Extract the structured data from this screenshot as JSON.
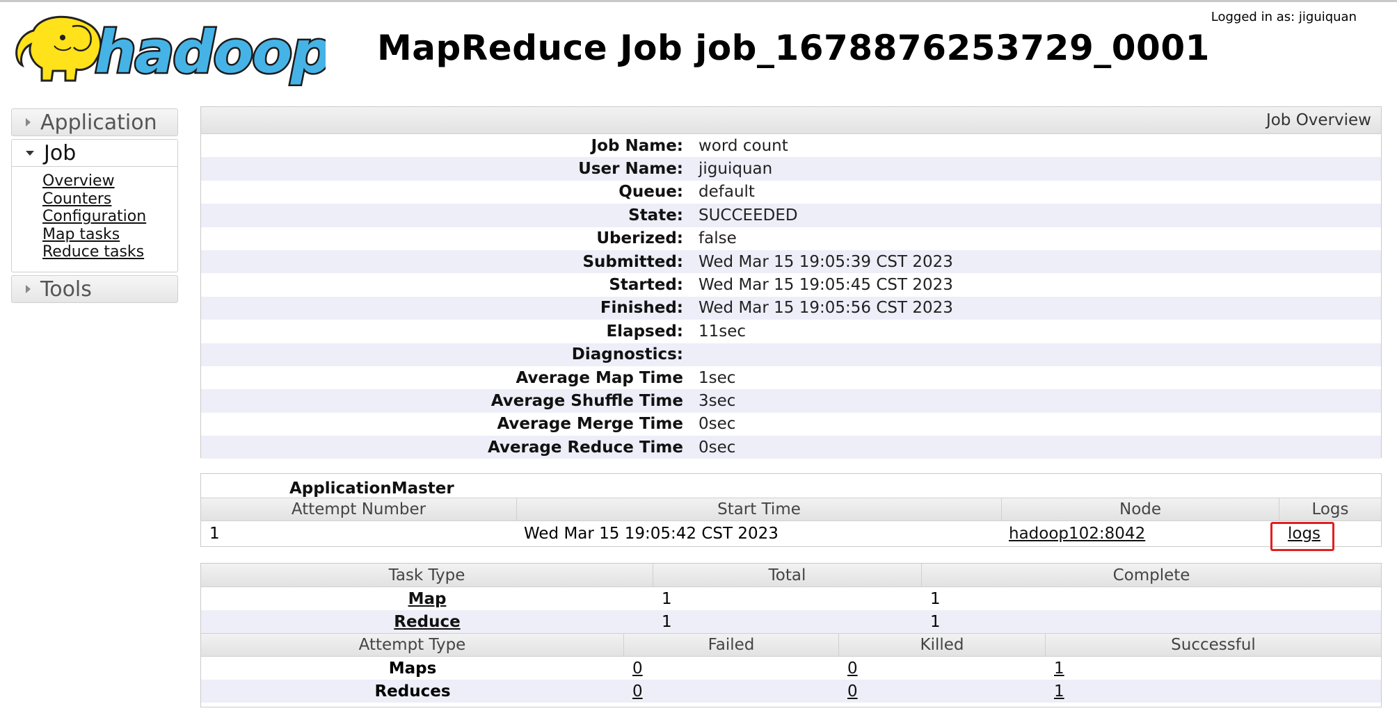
{
  "header": {
    "logo_text": "hadoop",
    "title": "MapReduce Job job_1678876253729_0001",
    "login_status": "Logged in as: jiguiquan"
  },
  "sidebar": {
    "application_label": "Application",
    "job_label": "Job",
    "job_links": [
      "Overview",
      "Counters",
      "Configuration",
      "Map tasks",
      "Reduce tasks"
    ],
    "tools_label": "Tools"
  },
  "overview": {
    "heading": "Job Overview",
    "rows": [
      {
        "key": "Job Name:",
        "value": "word count"
      },
      {
        "key": "User Name:",
        "value": "jiguiquan"
      },
      {
        "key": "Queue:",
        "value": "default"
      },
      {
        "key": "State:",
        "value": "SUCCEEDED"
      },
      {
        "key": "Uberized:",
        "value": "false"
      },
      {
        "key": "Submitted:",
        "value": "Wed Mar 15 19:05:39 CST 2023"
      },
      {
        "key": "Started:",
        "value": "Wed Mar 15 19:05:45 CST 2023"
      },
      {
        "key": "Finished:",
        "value": "Wed Mar 15 19:05:56 CST 2023"
      },
      {
        "key": "Elapsed:",
        "value": "11sec"
      },
      {
        "key": "Diagnostics:",
        "value": ""
      },
      {
        "key": "Average Map Time",
        "value": "1sec"
      },
      {
        "key": "Average Shuffle Time",
        "value": "3sec"
      },
      {
        "key": "Average Merge Time",
        "value": "0sec"
      },
      {
        "key": "Average Reduce Time",
        "value": "0sec"
      }
    ]
  },
  "app_master": {
    "title": "ApplicationMaster",
    "columns": [
      "Attempt Number",
      "Start Time",
      "Node",
      "Logs"
    ],
    "row": {
      "attempt": "1",
      "start_time": "Wed Mar 15 19:05:42 CST 2023",
      "node": "hadoop102:8042",
      "logs": "logs"
    }
  },
  "tasks": {
    "columns": [
      "Task Type",
      "Total",
      "Complete"
    ],
    "rows": [
      {
        "type": "Map",
        "total": "1",
        "complete": "1"
      },
      {
        "type": "Reduce",
        "total": "1",
        "complete": "1"
      }
    ],
    "attempt_columns": [
      "Attempt Type",
      "Failed",
      "Killed",
      "Successful"
    ],
    "attempt_rows": [
      {
        "type": "Maps",
        "failed": "0",
        "killed": "0",
        "successful": "1"
      },
      {
        "type": "Reduces",
        "failed": "0",
        "killed": "0",
        "successful": "1"
      }
    ]
  },
  "colors": {
    "logo_yellow": "#ffe21a",
    "logo_blue": "#46b3e6",
    "highlight_red": "#e02020",
    "row_stripe": "#eeeef9"
  }
}
